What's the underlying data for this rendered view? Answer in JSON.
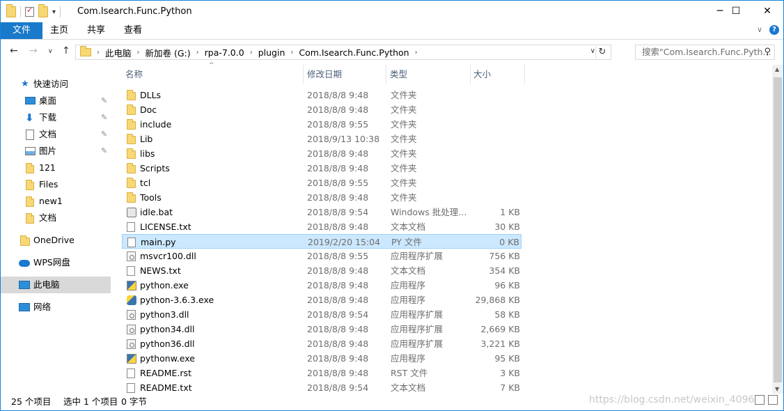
{
  "window": {
    "title": "Com.Isearch.Func.Python",
    "controls": {
      "minimize": "─",
      "maximize": "☐",
      "close": "✕"
    }
  },
  "ribbon": {
    "tabs": [
      "文件",
      "主页",
      "共享",
      "查看"
    ],
    "collapse": "∨",
    "help": "?"
  },
  "nav": {
    "back": "←",
    "forward": "→",
    "recent": "∨",
    "up": "↑"
  },
  "address": {
    "crumbs": [
      "此电脑",
      "新加卷 (G:)",
      "rpa-7.0.0",
      "plugin",
      "Com.Isearch.Func.Python"
    ],
    "separator": "›",
    "dropdown": "∨",
    "refresh": "↻"
  },
  "search": {
    "placeholder": "搜索\"Com.Isearch.Func.Pyth...",
    "icon": "search-icon"
  },
  "navpane": {
    "quick_access": "快速访问",
    "items": [
      {
        "label": "桌面",
        "icon": "desktop-icon",
        "pinned": true
      },
      {
        "label": "下载",
        "icon": "download-icon",
        "pinned": true
      },
      {
        "label": "文档",
        "icon": "documents-icon",
        "pinned": true
      },
      {
        "label": "图片",
        "icon": "pictures-icon",
        "pinned": true
      },
      {
        "label": "121",
        "icon": "folder-icon",
        "pinned": false
      },
      {
        "label": "Files",
        "icon": "folder-icon",
        "pinned": false
      },
      {
        "label": "new1",
        "icon": "folder-icon",
        "pinned": false
      },
      {
        "label": "文档",
        "icon": "folder-icon",
        "pinned": false
      }
    ],
    "onedrive": "OneDrive",
    "wps": "WPS网盘",
    "thispc": "此电脑",
    "network": "网络",
    "pin_glyph": "📌"
  },
  "columns": {
    "name": "名称",
    "date": "修改日期",
    "type": "类型",
    "size": "大小",
    "sort_glyph": "^"
  },
  "files": [
    {
      "name": "DLLs",
      "date": "2018/8/8 9:48",
      "type": "文件夹",
      "size": "",
      "icon": "folder"
    },
    {
      "name": "Doc",
      "date": "2018/8/8 9:48",
      "type": "文件夹",
      "size": "",
      "icon": "folder"
    },
    {
      "name": "include",
      "date": "2018/8/8 9:55",
      "type": "文件夹",
      "size": "",
      "icon": "folder"
    },
    {
      "name": "Lib",
      "date": "2018/9/13 10:38",
      "type": "文件夹",
      "size": "",
      "icon": "folder"
    },
    {
      "name": "libs",
      "date": "2018/8/8 9:48",
      "type": "文件夹",
      "size": "",
      "icon": "folder"
    },
    {
      "name": "Scripts",
      "date": "2018/8/8 9:48",
      "type": "文件夹",
      "size": "",
      "icon": "folder"
    },
    {
      "name": "tcl",
      "date": "2018/8/8 9:55",
      "type": "文件夹",
      "size": "",
      "icon": "folder"
    },
    {
      "name": "Tools",
      "date": "2018/8/8 9:48",
      "type": "文件夹",
      "size": "",
      "icon": "folder"
    },
    {
      "name": "idle.bat",
      "date": "2018/8/8 9:54",
      "type": "Windows 批处理...",
      "size": "1 KB",
      "icon": "bat"
    },
    {
      "name": "LICENSE.txt",
      "date": "2018/8/8 9:48",
      "type": "文本文档",
      "size": "30 KB",
      "icon": "file"
    },
    {
      "name": "main.py",
      "date": "2019/2/20 15:04",
      "type": "PY 文件",
      "size": "0 KB",
      "icon": "file",
      "selected": true
    },
    {
      "name": "msvcr100.dll",
      "date": "2018/8/8 9:55",
      "type": "应用程序扩展",
      "size": "756 KB",
      "icon": "dll"
    },
    {
      "name": "NEWS.txt",
      "date": "2018/8/8 9:48",
      "type": "文本文档",
      "size": "354 KB",
      "icon": "file"
    },
    {
      "name": "python.exe",
      "date": "2018/8/8 9:48",
      "type": "应用程序",
      "size": "96 KB",
      "icon": "py"
    },
    {
      "name": "python-3.6.3.exe",
      "date": "2018/8/8 9:48",
      "type": "应用程序",
      "size": "29,868 KB",
      "icon": "inst"
    },
    {
      "name": "python3.dll",
      "date": "2018/8/8 9:54",
      "type": "应用程序扩展",
      "size": "58 KB",
      "icon": "dll"
    },
    {
      "name": "python34.dll",
      "date": "2018/8/8 9:48",
      "type": "应用程序扩展",
      "size": "2,669 KB",
      "icon": "dll"
    },
    {
      "name": "python36.dll",
      "date": "2018/8/8 9:48",
      "type": "应用程序扩展",
      "size": "3,221 KB",
      "icon": "dll"
    },
    {
      "name": "pythonw.exe",
      "date": "2018/8/8 9:48",
      "type": "应用程序",
      "size": "95 KB",
      "icon": "py"
    },
    {
      "name": "README.rst",
      "date": "2018/8/8 9:48",
      "type": "RST 文件",
      "size": "3 KB",
      "icon": "file"
    },
    {
      "name": "README.txt",
      "date": "2018/8/8 9:54",
      "type": "文本文档",
      "size": "7 KB",
      "icon": "file"
    }
  ],
  "status": {
    "count": "25 个项目",
    "selected": "选中 1 个项目",
    "size": "0 字节"
  },
  "watermark": "https://blog.csdn.net/weixin_4096",
  "scroll": {
    "up": "▲",
    "down": "▼"
  },
  "colors": {
    "accent": "#1979ca",
    "selection": "#cce8ff",
    "selection_border": "#99d1ff",
    "folder": "#f8d775"
  }
}
